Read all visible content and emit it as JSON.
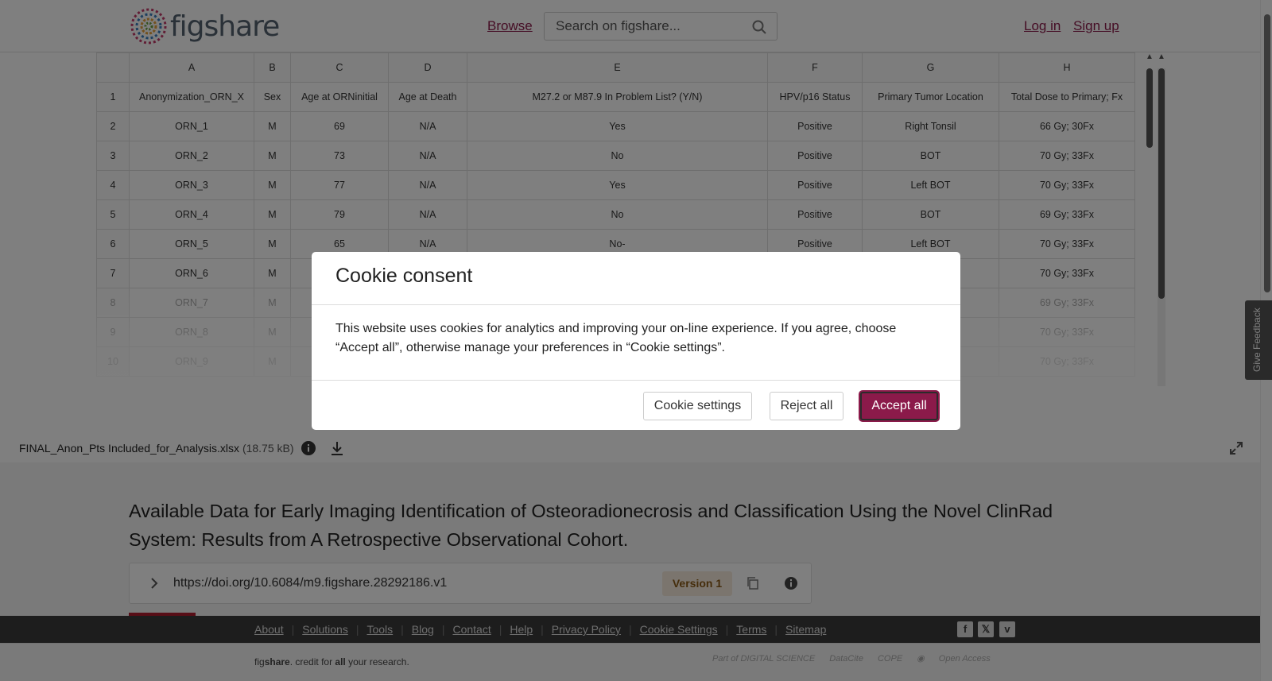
{
  "header": {
    "logo_text": "figshare",
    "browse": "Browse",
    "search_placeholder": "Search on figshare...",
    "login": "Log in",
    "signup": "Sign up"
  },
  "sheet": {
    "columns": [
      "A",
      "B",
      "C",
      "D",
      "E",
      "F",
      "G",
      "H"
    ],
    "rows": [
      [
        "1",
        "Anonymization_ORN_X",
        "Sex",
        "Age at ORNinitial",
        "Age at Death",
        "M27.2 or M87.9 In Problem List? (Y/N)",
        "HPV/p16 Status",
        "Primary Tumor Location",
        "Total Dose to Primary; Fx"
      ],
      [
        "2",
        "ORN_1",
        "M",
        "69",
        "N/A",
        "Yes",
        "Positive",
        "Right Tonsil",
        "66 Gy; 30Fx"
      ],
      [
        "3",
        "ORN_2",
        "M",
        "73",
        "N/A",
        "No",
        "Positive",
        "BOT",
        "70 Gy; 33Fx"
      ],
      [
        "4",
        "ORN_3",
        "M",
        "77",
        "N/A",
        "Yes",
        "Positive",
        "Left BOT",
        "70 Gy; 33Fx"
      ],
      [
        "5",
        "ORN_4",
        "M",
        "79",
        "N/A",
        "No",
        "Positive",
        "BOT",
        "69 Gy; 33Fx"
      ],
      [
        "6",
        "ORN_5",
        "M",
        "65",
        "N/A",
        "No-",
        "Positive",
        "Left BOT",
        "70 Gy; 33Fx"
      ],
      [
        "7",
        "ORN_6",
        "M",
        "",
        "",
        "",
        "",
        "",
        "70 Gy; 33Fx"
      ],
      [
        "8",
        "ORN_7",
        "M",
        "",
        "",
        "",
        "",
        "",
        "69 Gy; 33Fx"
      ],
      [
        "9",
        "ORN_8",
        "M",
        "",
        "",
        "",
        "",
        "",
        "70 Gy; 33Fx"
      ],
      [
        "10",
        "ORN_9",
        "M",
        "",
        "",
        "",
        "",
        "",
        "70 Gy; 33Fx"
      ]
    ]
  },
  "file": {
    "name": "FINAL_Anon_Pts Included_for_Analysis.xlsx",
    "size": "(18.75 kB)"
  },
  "main": {
    "title": "Available Data for Early Imaging Identification of Osteoradionecrosis and Classification Using the Novel ClinRad System: Results from A Retrospective Observational Cohort.",
    "doi": "https://doi.org/10.6084/m9.figshare.28292186.v1",
    "version": "Version 1"
  },
  "footer": {
    "links": [
      "About",
      "Solutions",
      "Tools",
      "Blog",
      "Contact",
      "Help",
      "Privacy Policy",
      "Cookie Settings",
      "Terms",
      "Sitemap"
    ],
    "tagline_pre": "fig",
    "tagline_bold": "share",
    "tagline_mid": ". credit for ",
    "tagline_all": "all",
    "tagline_post": " your research.",
    "partners": [
      "Part of DIGITAL SCIENCE",
      "DataCite",
      "COPE",
      "Open Access"
    ]
  },
  "feedback": "Give Feedback",
  "modal": {
    "title": "Cookie consent",
    "body": "This website uses cookies for analytics and improving your on-line experience. If you agree, choose “Accept all”, otherwise manage your preferences in “Cookie settings”.",
    "settings": "Cookie settings",
    "reject": "Reject all",
    "accept": "Accept all"
  },
  "colors": {
    "brand": "#8b1a4a",
    "version_bg": "#f7ebdd",
    "footer_bg": "#3a3a3a"
  }
}
